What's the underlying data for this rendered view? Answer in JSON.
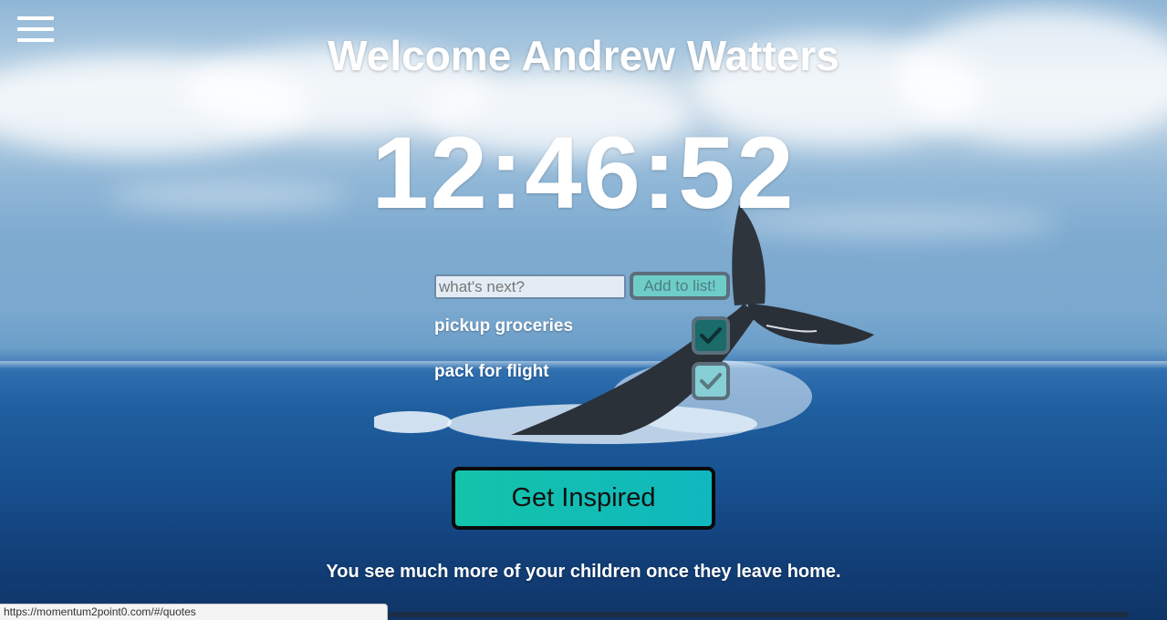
{
  "header": {
    "welcome_text": "Welcome Andrew Watters"
  },
  "clock": {
    "time": "12:46:52"
  },
  "todo": {
    "input_placeholder": "what's next?",
    "add_button_label": "Add to list!",
    "items": [
      {
        "label": "pickup groceries",
        "checked": true
      },
      {
        "label": "pack for flight",
        "checked": true
      }
    ]
  },
  "inspire": {
    "button_label": "Get Inspired"
  },
  "quote": {
    "text": "You see much more of your children once they leave home."
  },
  "status_bar": {
    "url": "https://momentum2point0.com/#/quotes"
  },
  "colors": {
    "accent_teal": "#13c3a9",
    "text_white": "#ffffff"
  },
  "icons": {
    "menu": "hamburger-menu-icon",
    "check": "checkmark-icon"
  }
}
